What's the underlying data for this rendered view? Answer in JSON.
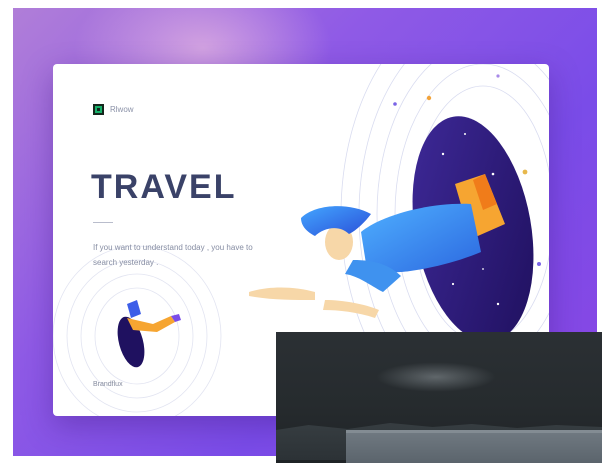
{
  "card": {
    "logo_text": "Rlwow",
    "title": "TRAVEL",
    "tagline": "If you want to understand today , you have to search yesterday .",
    "brand": "Brandflux"
  },
  "colors": {
    "background_gradient": [
      "#b07ed8",
      "#7a4ce8"
    ],
    "title": "#3a4268",
    "portal": "#2a1770",
    "shirt": "#3d8ef0",
    "hair": "#2f6fe0",
    "pants": "#f6a531",
    "logo": "#18b06a"
  },
  "icons": {
    "logo": "square-logo-icon"
  }
}
